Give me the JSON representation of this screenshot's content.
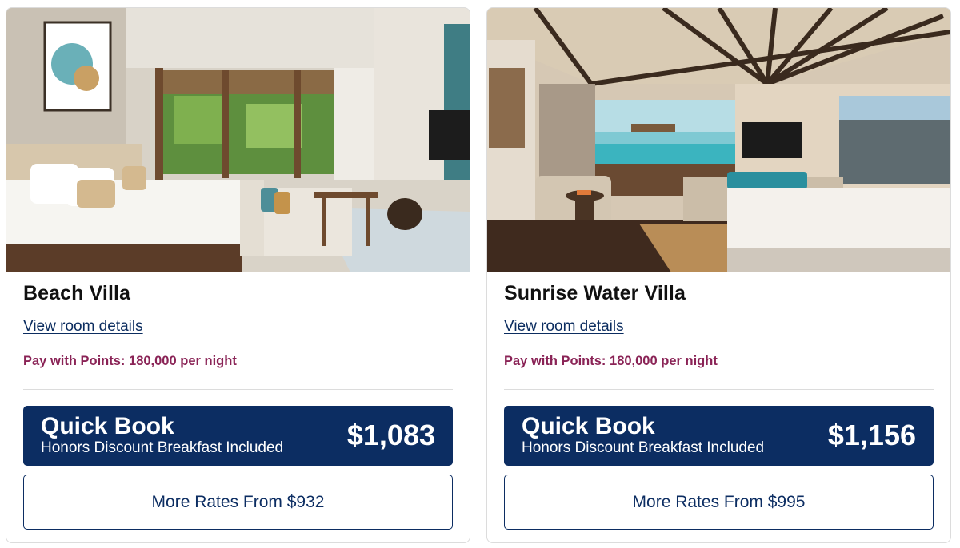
{
  "rooms": [
    {
      "name": "Beach Villa",
      "details_link": "View room details",
      "points": "Pay with Points: 180,000 per night",
      "quick_book": {
        "title": "Quick Book",
        "subtitle": "Honors Discount Breakfast Included",
        "price": "$1,083"
      },
      "more_rates": "More Rates From $932"
    },
    {
      "name": "Sunrise Water Villa",
      "details_link": "View room details",
      "points": "Pay with Points: 180,000 per night",
      "quick_book": {
        "title": "Quick Book",
        "subtitle": "Honors Discount Breakfast Included",
        "price": "$1,156"
      },
      "more_rates": "More Rates From $995"
    }
  ],
  "colors": {
    "navy": "#0c2d62",
    "points_magenta": "#8a2356",
    "card_border": "#dcdcdc"
  }
}
